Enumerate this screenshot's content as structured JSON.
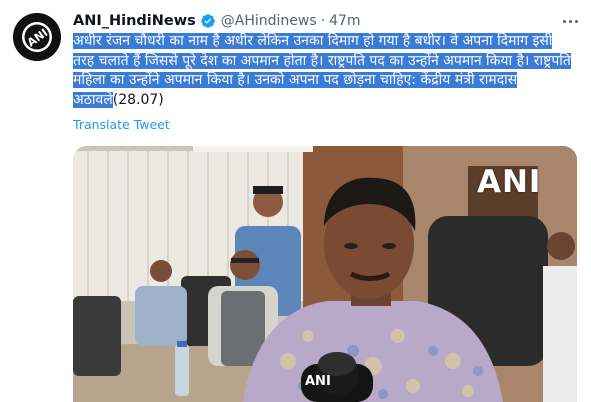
{
  "tweet": {
    "display_name": "ANI_HindiNews",
    "handle": "@AHindinews",
    "separator": "·",
    "time": "47m",
    "text_highlighted": "अधीर रंजन चौधरी का नाम है अधीर लेकिन उनका दिमाग हो गया है बधीर। वे अपना दिमाग इसी तरह चलाते हैं जिससे पूरे देश का अपमान होता है। राष्ट्रपति पद का उन्होंने अपमान किया है। राष्ट्रपति महिला का उन्होंने अपमान किया है। उनको अपना पद छोड़ना चाहिए: केंद्रीय मंत्री रामदास अठावले",
    "text_plain": "(28.07)",
    "translate_label": "Translate Tweet"
  },
  "avatar": {
    "logo_text": "ANI"
  },
  "media": {
    "watermark": "ANI",
    "mic_label": "ANI"
  },
  "icons": [
    "verified-badge-icon",
    "more-options-icon"
  ],
  "colors": {
    "accent": "#1d9bf0",
    "selection": "#3b7bd8",
    "secondary_text": "#536471"
  }
}
